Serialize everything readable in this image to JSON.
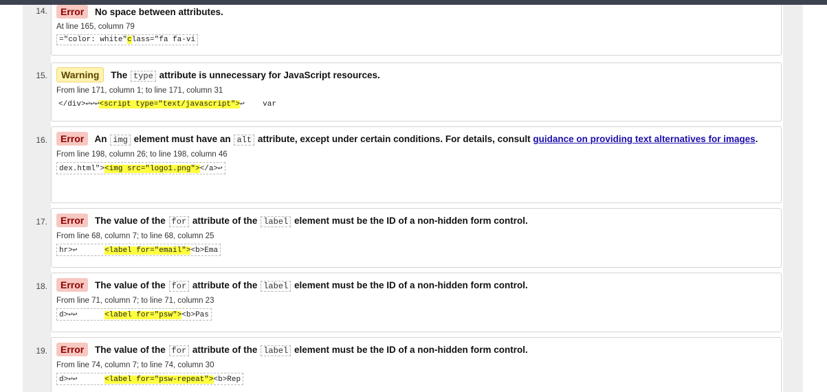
{
  "messages": [
    {
      "number": "14.",
      "type": "Error",
      "pre": "",
      "code1": "",
      "mid": "No space between attributes.",
      "code2": "",
      "post": "",
      "location": "At line 165, column 79",
      "extract_before": "=\"color: white\"",
      "extract_highlight": "c",
      "extract_after": "lass=\"fa fa-vi"
    },
    {
      "number": "15.",
      "type": "Warning",
      "pre": "The",
      "code1": "type",
      "mid": "attribute is unnecessary for JavaScript resources.",
      "location": "From line 171, column 1; to line 171, column 31",
      "extract_before": "</div>↩↩↩",
      "extract_highlight": "<script type=\"text/javascript\">",
      "extract_after": "↩    var"
    },
    {
      "number": "16.",
      "type": "Error",
      "pre": "An",
      "code1": "img",
      "mid": "element must have an",
      "code2": "alt",
      "post": "attribute, except under certain conditions. For details, consult",
      "link": "guidance on providing text alternatives for images",
      "location": "From line 198, column 26; to line 198, column 46",
      "extract_before": "dex.html\">",
      "extract_highlight": "<img src=\"logo1.png\">",
      "extract_after": "</a>↩"
    },
    {
      "number": "17.",
      "type": "Error",
      "pre": "The value of the",
      "code1": "for",
      "mid": "attribute of the",
      "code2": "label",
      "post": "element must be the ID of a non-hidden form control.",
      "location": "From line 68, column 7; to line 68, column 25",
      "extract_before": "hr>↩      ",
      "extract_highlight": "<label for=\"email\">",
      "extract_after": "<b>Ema"
    },
    {
      "number": "18.",
      "type": "Error",
      "pre": "The value of the",
      "code1": "for",
      "mid": "attribute of the",
      "code2": "label",
      "post": "element must be the ID of a non-hidden form control.",
      "location": "From line 71, column 7; to line 71, column 23",
      "extract_before": "d>↩↩      ",
      "extract_highlight": "<label for=\"psw\">",
      "extract_after": "<b>Pas"
    },
    {
      "number": "19.",
      "type": "Error",
      "pre": "The value of the",
      "code1": "for",
      "mid": "attribute of the",
      "code2": "label",
      "post": "element must be the ID of a non-hidden form control.",
      "location": "From line 74, column 7; to line 74, column 30",
      "extract_before": "d>↩↩      ",
      "extract_highlight": "<label for=\"psw-repeat\">",
      "extract_after": "<b>Rep"
    }
  ]
}
